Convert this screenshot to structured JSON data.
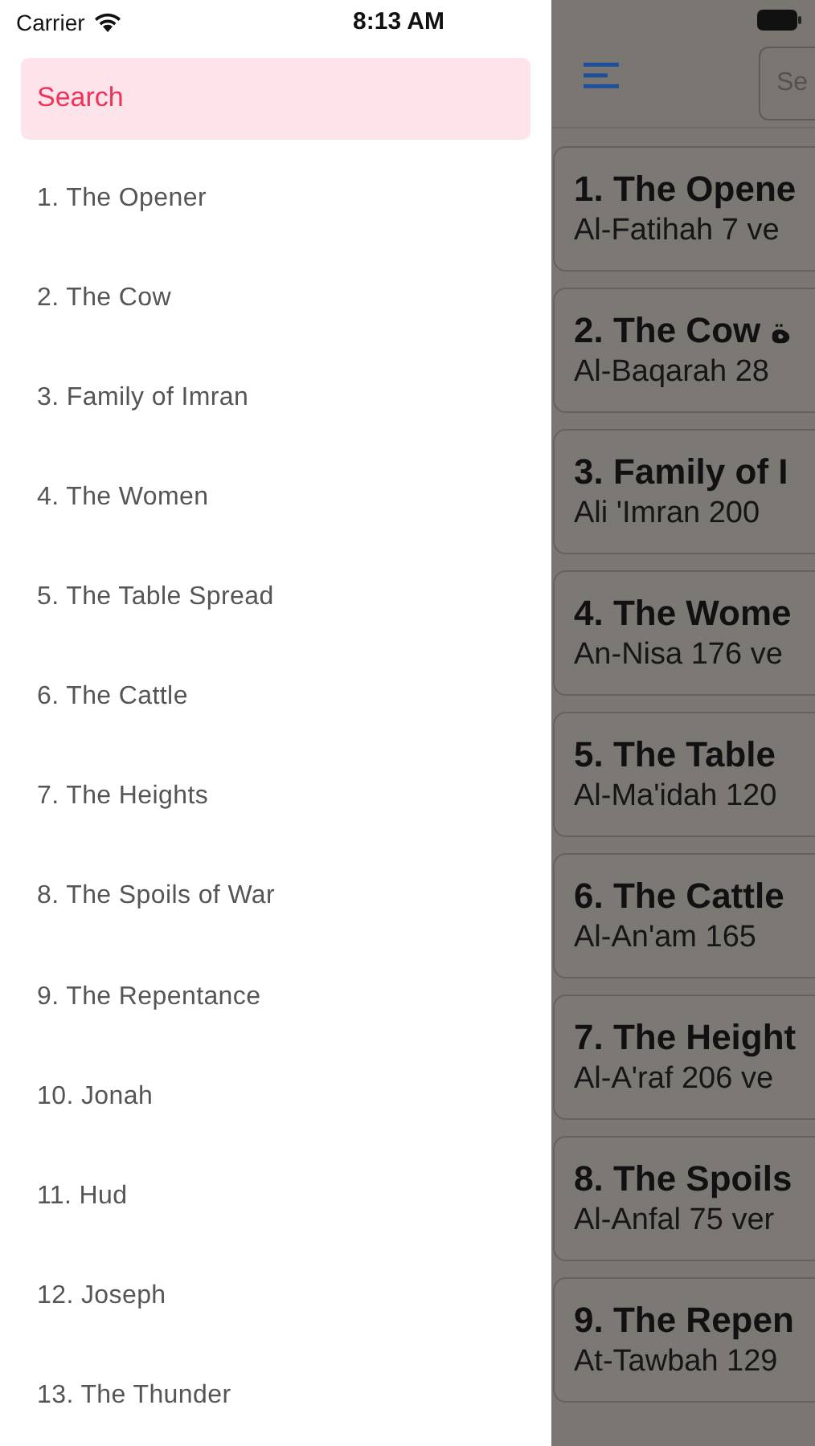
{
  "status_bar": {
    "carrier": "Carrier",
    "time": "8:13 AM"
  },
  "drawer": {
    "search": {
      "placeholder": "Search"
    },
    "items": [
      {
        "label": "1. The Opener"
      },
      {
        "label": "2. The Cow"
      },
      {
        "label": "3. Family of Imran"
      },
      {
        "label": "4. The Women"
      },
      {
        "label": "5. The Table Spread"
      },
      {
        "label": "6. The Cattle"
      },
      {
        "label": "7. The Heights"
      },
      {
        "label": "8. The Spoils of War"
      },
      {
        "label": "9. The Repentance"
      },
      {
        "label": "10. Jonah"
      },
      {
        "label": "11. Hud"
      },
      {
        "label": "12. Joseph"
      },
      {
        "label": "13. The Thunder"
      }
    ]
  },
  "main": {
    "search": {
      "placeholder": "Se"
    },
    "cards": [
      {
        "title": "1. The Opene",
        "subtitle": "Al-Fatihah 7 ve"
      },
      {
        "title": "2. The Cow ة",
        "subtitle": "Al-Baqarah 28"
      },
      {
        "title": "3. Family of I",
        "subtitle": "Ali 'Imran 200"
      },
      {
        "title": "4. The Wome",
        "subtitle": "An-Nisa 176 ve"
      },
      {
        "title": "5. The Table",
        "subtitle": "Al-Ma'idah 120"
      },
      {
        "title": "6. The Cattle",
        "subtitle": "Al-An'am 165"
      },
      {
        "title": "7. The Height",
        "subtitle": "Al-A'raf 206 ve"
      },
      {
        "title": "8. The Spoils",
        "subtitle": "Al-Anfal 75 ver"
      },
      {
        "title": "9. The Repen",
        "subtitle": "At-Tawbah 129"
      }
    ]
  }
}
